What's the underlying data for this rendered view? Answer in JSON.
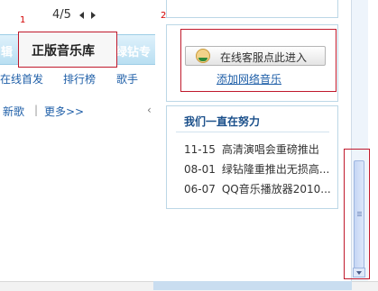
{
  "annotations": {
    "label1": "1",
    "label2": "2"
  },
  "pager": {
    "text": "4/5"
  },
  "tabs": {
    "left_partial": "辑",
    "active": "正版音乐库",
    "right_partial": "绿钻专"
  },
  "nav": {
    "items": [
      "在线首发",
      "排行榜",
      "歌手"
    ]
  },
  "sub": {
    "new_songs": "新歌",
    "pipe": "|",
    "more": "更多>>",
    "marker": "‹"
  },
  "service": {
    "button_label": "在线客服点此进入",
    "link_text": "添加网络音乐"
  },
  "news": {
    "title": "我们一直在努力",
    "items": [
      {
        "date": "11-15",
        "text": "高清演唱会重磅推出"
      },
      {
        "date": "08-01",
        "text": "绿钻隆重推出无损高..."
      },
      {
        "date": "06-07",
        "text": "QQ音乐播放器2010..."
      }
    ]
  },
  "colors": {
    "annotation_red": "#c0192c",
    "link_blue": "#1f5fa8",
    "tab_gradient_top": "#dff1fb",
    "tab_gradient_bottom": "#b9dff2"
  }
}
